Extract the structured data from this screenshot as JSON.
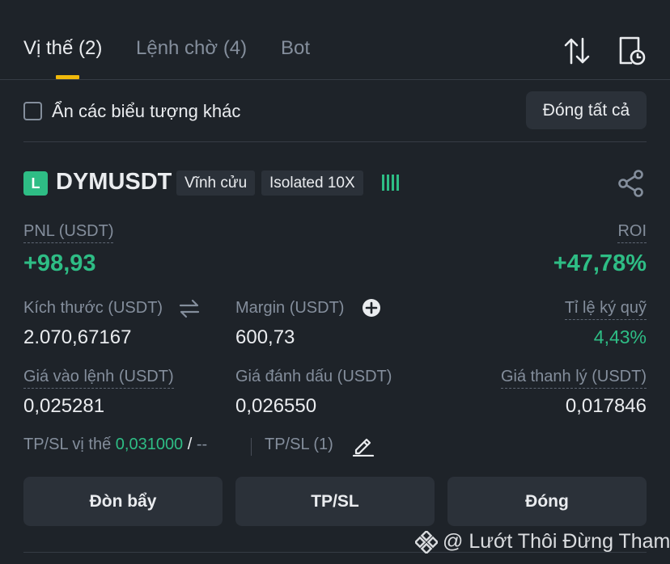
{
  "tabs": [
    {
      "label": "Vị thế (2)",
      "active": true
    },
    {
      "label": "Lệnh chờ (4)",
      "active": false
    },
    {
      "label": "Bot",
      "active": false
    }
  ],
  "icons": {
    "sort": "sort-arrows-icon",
    "history": "document-clock-icon",
    "share": "share-icon",
    "edit": "pencil-icon",
    "add": "plus-circle-icon",
    "swap": "swap-arrows-icon",
    "signal": "signal-bars-icon",
    "logo": "binance-logo-icon"
  },
  "filter": {
    "hide_other_label": "Ẩn các biểu tượng khác",
    "checked": false,
    "close_all_label": "Đóng tất cả"
  },
  "position": {
    "side_badge": "L",
    "symbol": "DYMUSDT",
    "type_tag": "Vĩnh cửu",
    "margin_tag": "Isolated 10X",
    "pnl_label": "PNL (USDT)",
    "pnl_value": "+98,93",
    "roi_label": "ROI",
    "roi_value": "+47,78%",
    "size_label": "Kích thước (USDT)",
    "size_value": "2.070,67167",
    "margin_label": "Margin (USDT)",
    "margin_value": "600,73",
    "margin_ratio_label": "Tỉ lệ ký quỹ",
    "margin_ratio_value": "4,43%",
    "entry_label": "Giá vào lệnh (USDT)",
    "entry_value": "0,025281",
    "mark_label": "Giá đánh dấu (USDT)",
    "mark_value": "0,026550",
    "liq_label": "Giá thanh lý (USDT)",
    "liq_value": "0,017846",
    "tpsl_position_label": "TP/SL vị thế",
    "tpsl_position_tp": "0,031000",
    "tpsl_position_sep": "/",
    "tpsl_position_sl": "--",
    "tpsl_orders_label": "TP/SL (1)"
  },
  "actions": {
    "leverage": "Đòn bẩy",
    "tpsl": "TP/SL",
    "close": "Đóng"
  },
  "watermark": "@ Lướt Thôi Đừng Tham",
  "colors": {
    "background": "#1e2329",
    "accent": "#f0b90b",
    "profit": "#2ebd85",
    "muted": "#848e9c",
    "button": "#2b3139"
  }
}
